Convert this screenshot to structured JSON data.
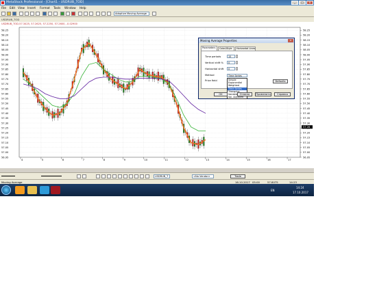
{
  "window": {
    "title": "MetaStock Professional - [Chart1 - USDRUB_TOD]",
    "app_icon": "metastock-icon"
  },
  "menu": [
    "File",
    "Edit",
    "View",
    "Insert",
    "Format",
    "Tools",
    "Window",
    "Help"
  ],
  "toolbar": {
    "indicator_select": "Adaptive Moving Average"
  },
  "chart": {
    "header": "USDRUB_TOD",
    "info": "USDRUB_TOD-57.3425, 57.2625, 57.2250, 57.2600, -0.02900",
    "y_ticks": [
      "58.25",
      "58.20",
      "58.15",
      "58.10",
      "58.05",
      "58.00",
      "57.95",
      "57.90",
      "57.85",
      "57.80",
      "57.75",
      "57.70",
      "57.65",
      "57.60",
      "57.55",
      "57.50",
      "57.45",
      "57.40",
      "57.35",
      "57.30",
      "57.25",
      "57.20",
      "57.15",
      "57.10",
      "57.05",
      "57.00",
      "56.95"
    ],
    "current_price_label": "57.26",
    "x_ticks": [
      "4",
      "5",
      "6",
      "7",
      "8",
      "9",
      "10",
      "11",
      "12",
      "13",
      "14",
      "15",
      "16",
      "17"
    ],
    "colors": {
      "ma_orange": "#f07020",
      "ma_green": "#30b030",
      "ma_purple": "#6020a0",
      "bull": "#208020",
      "bear": "#c02020"
    }
  },
  "chart_data": {
    "type": "line",
    "title": "USDRUB_TOD",
    "ylabel": "",
    "ylim": [
      56.95,
      58.28
    ],
    "series": [
      {
        "values": [
          57.82,
          57.7,
          57.55,
          57.45,
          57.38,
          57.4,
          57.5,
          57.75,
          58.05,
          58.12,
          58.0,
          57.85,
          57.75,
          57.7,
          57.65,
          57.72,
          57.85,
          57.8,
          57.78,
          57.77,
          57.7,
          57.5,
          57.25,
          57.1,
          57.08,
          57.13
        ]
      },
      {
        "values": [
          57.75,
          57.7,
          57.62,
          57.55,
          57.48,
          57.46,
          57.5,
          57.6,
          57.78,
          57.9,
          57.92,
          57.85,
          57.8,
          57.75,
          57.72,
          57.73,
          57.78,
          57.78,
          57.77,
          57.75,
          57.7,
          57.55,
          57.38,
          57.26,
          57.22,
          57.22
        ]
      },
      {
        "values": [
          57.7,
          57.68,
          57.65,
          57.6,
          57.57,
          57.55,
          57.55,
          57.58,
          57.65,
          57.72,
          57.76,
          57.77,
          57.77,
          57.76,
          57.75,
          57.75,
          57.76,
          57.76,
          57.76,
          57.75,
          57.73,
          57.66,
          57.58,
          57.5,
          57.44,
          57.4
        ]
      }
    ]
  },
  "dialog": {
    "title": "Moving Average Properties",
    "close": "x",
    "tabs": [
      "Parameters",
      "Color/Style",
      "Horizontal Lines"
    ],
    "time_periods_label": "Time periods",
    "time_periods_value": "15",
    "vertical_shift_label": "Vertical shift %",
    "vertical_shift_value": "0",
    "horizontal_shift_label": "Horizontal shift",
    "horizontal_shift_value": "0",
    "method_label": "Method",
    "method_value": "Time Series",
    "price_field_label": "Price field",
    "defaults_button": "Defaults",
    "method_options": [
      "Simple",
      "Exponential",
      "Weighted",
      "Time Series",
      "Triangular",
      "Variable",
      "Vol. Adjusted"
    ],
    "ok_button": "OK",
    "cancel_button": "Отмена",
    "apply_button": "Применить",
    "help_button": "Справка"
  },
  "bottom": {
    "symbol_select": "USDRUB_T",
    "vendor_select": "<No Vendor>",
    "trade_button": "Trade"
  },
  "status": {
    "left": "Moving Average",
    "date": "16.10.2017",
    "time": "05:00",
    "price": "57.8075",
    "clock": "14:23"
  },
  "tray": {
    "lang": "EN",
    "time": "14:24",
    "date": "17.10.2017"
  }
}
